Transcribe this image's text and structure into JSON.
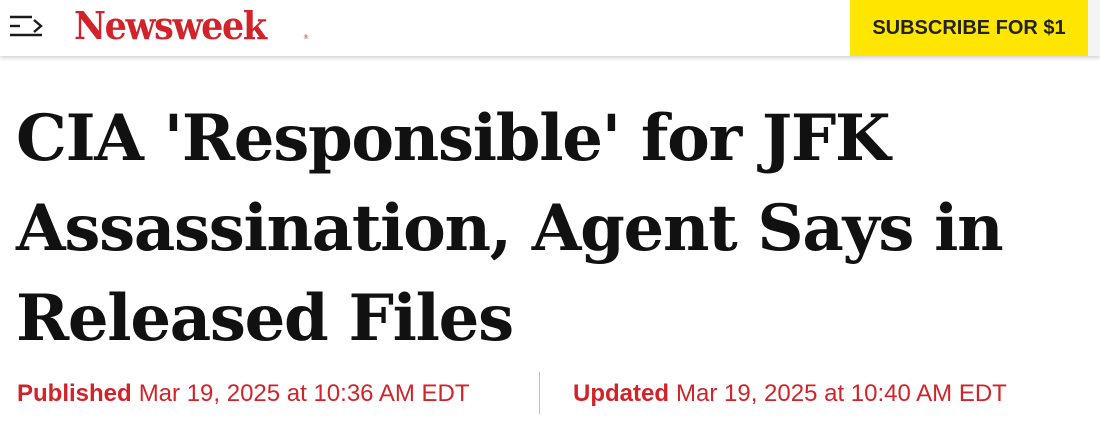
{
  "colors": {
    "brand_red": "#d2232a",
    "subscribe_yellow": "#ffe600",
    "headline_text": "#111111",
    "meta_red": "#d2232a",
    "divider": "#bfbfbf"
  },
  "header": {
    "menu_icon": "menu-arrow-icon",
    "logo_text": "Newsweek",
    "logo_mark": "®",
    "subscribe_label": "SUBSCRIBE FOR $1"
  },
  "article": {
    "headline": "CIA 'Responsible' for JFK Assassination, Agent Says in Released Files",
    "published_label": "Published",
    "published_date": "Mar 19, 2025 at 10:36 AM EDT",
    "updated_label": "Updated",
    "updated_date": "Mar 19, 2025 at 10:40 AM EDT"
  }
}
